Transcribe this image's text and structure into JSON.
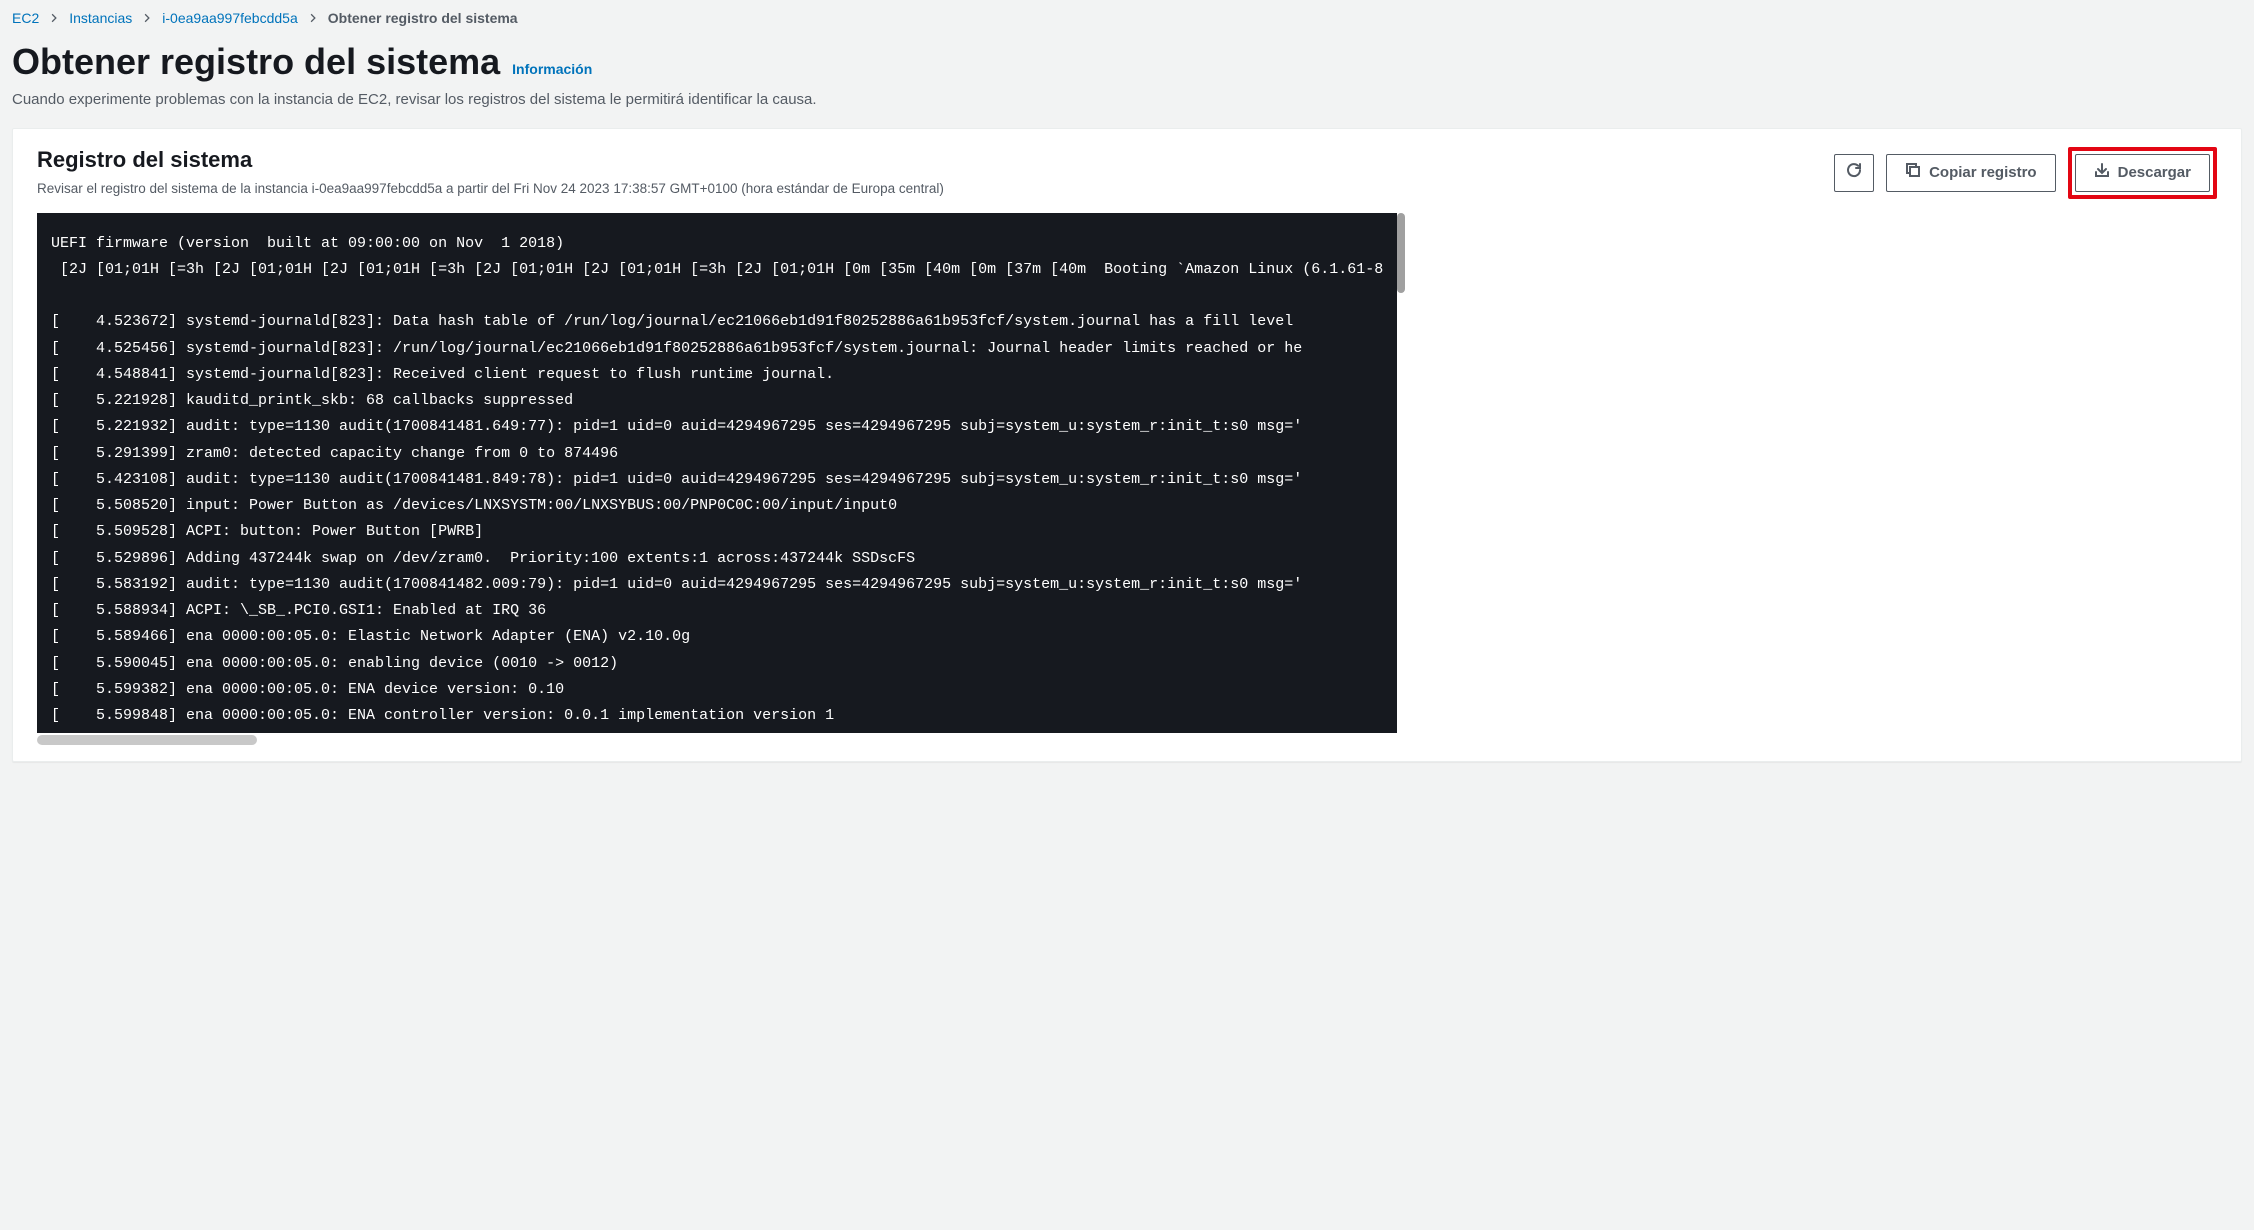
{
  "breadcrumb": {
    "ec2": "EC2",
    "instances": "Instancias",
    "instance_id": "i-0ea9aa997febcdd5a",
    "current": "Obtener registro del sistema"
  },
  "header": {
    "title": "Obtener registro del sistema",
    "info_link": "Información",
    "description": "Cuando experimente problemas con la instancia de EC2, revisar los registros del sistema le permitirá identificar la causa."
  },
  "panel": {
    "title": "Registro del sistema",
    "description": "Revisar el registro del sistema de la instancia i-0ea9aa997febcdd5a a partir del Fri Nov 24 2023 17:38:57 GMT+0100 (hora estándar de Europa central)",
    "buttons": {
      "refresh_aria": "Actualizar",
      "copy": "Copiar registro",
      "download": "Descargar"
    }
  },
  "log": "UEFI firmware (version  built at 09:00:00 on Nov  1 2018)\n [2J [01;01H [=3h [2J [01;01H [2J [01;01H [=3h [2J [01;01H [2J [01;01H [=3h [2J [01;01H [0m [35m [40m [0m [37m [40m  Booting `Amazon Linux (6.1.61-8\n\n[    4.523672] systemd-journald[823]: Data hash table of /run/log/journal/ec21066eb1d91f80252886a61b953fcf/system.journal has a fill level \n[    4.525456] systemd-journald[823]: /run/log/journal/ec21066eb1d91f80252886a61b953fcf/system.journal: Journal header limits reached or he\n[    4.548841] systemd-journald[823]: Received client request to flush runtime journal.\n[    5.221928] kauditd_printk_skb: 68 callbacks suppressed\n[    5.221932] audit: type=1130 audit(1700841481.649:77): pid=1 uid=0 auid=4294967295 ses=4294967295 subj=system_u:system_r:init_t:s0 msg='\n[    5.291399] zram0: detected capacity change from 0 to 874496\n[    5.423108] audit: type=1130 audit(1700841481.849:78): pid=1 uid=0 auid=4294967295 ses=4294967295 subj=system_u:system_r:init_t:s0 msg='\n[    5.508520] input: Power Button as /devices/LNXSYSTM:00/LNXSYBUS:00/PNP0C0C:00/input/input0\n[    5.509528] ACPI: button: Power Button [PWRB]\n[    5.529896] Adding 437244k swap on /dev/zram0.  Priority:100 extents:1 across:437244k SSDscFS\n[    5.583192] audit: type=1130 audit(1700841482.009:79): pid=1 uid=0 auid=4294967295 ses=4294967295 subj=system_u:system_r:init_t:s0 msg='\n[    5.588934] ACPI: \\_SB_.PCI0.GSI1: Enabled at IRQ 36\n[    5.589466] ena 0000:00:05.0: Elastic Network Adapter (ENA) v2.10.0g\n[    5.590045] ena 0000:00:05.0: enabling device (0010 -> 0012)\n[    5.599382] ena 0000:00:05.0: ENA device version: 0.10\n[    5.599848] ena 0000:00:05.0: ENA controller version: 0.0.1 implementation version 1"
}
